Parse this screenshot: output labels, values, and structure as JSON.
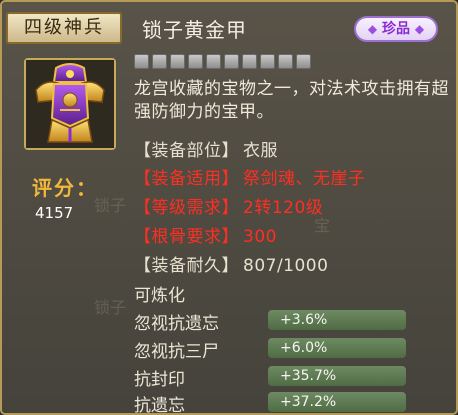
{
  "header": {
    "tier_badge": "四级神兵",
    "item_name": "锁子黄金甲",
    "rarity_badge": "珍品"
  },
  "gem_slots": 10,
  "item_icon": "golden-armor-icon",
  "description": "龙宫收藏的宝物之一，对法术攻击拥有超强防御力的宝甲。",
  "score": {
    "label": "评分：",
    "value": "4157"
  },
  "attributes": [
    {
      "label": "【装备部位】",
      "value": "衣服",
      "color": "#e6e0cf"
    },
    {
      "label": "【装备适用】",
      "value": "祭剑魂、无崖子",
      "color": "#ff2e22"
    },
    {
      "label": "【等级需求】",
      "value": "2转120级",
      "color": "#ff2e22"
    },
    {
      "label": "【根骨要求】",
      "value": "300",
      "color": "#ff2e22"
    },
    {
      "label": "【装备耐久】",
      "value": "807/1000",
      "color": "#e6e0cf"
    }
  ],
  "refine_note": "可炼化",
  "stats": [
    {
      "name": "忽视抗遗忘",
      "value": "+3.6%"
    },
    {
      "name": "忽视抗三尸",
      "value": "+6.0%"
    },
    {
      "name": "抗封印",
      "value": "+35.7%"
    },
    {
      "name": "抗遗忘",
      "value": "+37.2%"
    }
  ],
  "colors": {
    "panel_border": "#b59b57",
    "score_label": "#f2b83a",
    "requirement_red": "#ff2e22",
    "stat_bar_green": "#5e7b53",
    "rarity_purple": "#8a2bd0"
  }
}
